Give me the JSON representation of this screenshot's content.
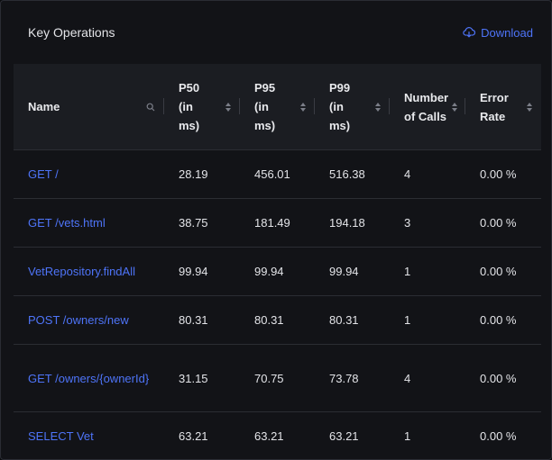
{
  "panel": {
    "title": "Key Operations",
    "download_label": "Download"
  },
  "columns": [
    {
      "label": "Name"
    },
    {
      "label": "P50 (in ms)"
    },
    {
      "label": "P95 (in ms)"
    },
    {
      "label": "P99 (in ms)"
    },
    {
      "label": "Number of Calls"
    },
    {
      "label": "Error Rate"
    }
  ],
  "rows": [
    {
      "name": "GET /",
      "p50": "28.19",
      "p95": "456.01",
      "p99": "516.38",
      "calls": "4",
      "error_rate": "0.00 %"
    },
    {
      "name": "GET /vets.html",
      "p50": "38.75",
      "p95": "181.49",
      "p99": "194.18",
      "calls": "3",
      "error_rate": "0.00 %"
    },
    {
      "name": "VetRepository.findAll",
      "p50": "99.94",
      "p95": "99.94",
      "p99": "99.94",
      "calls": "1",
      "error_rate": "0.00 %"
    },
    {
      "name": "POST /owners/new",
      "p50": "80.31",
      "p95": "80.31",
      "p99": "80.31",
      "calls": "1",
      "error_rate": "0.00 %"
    },
    {
      "name": "GET /owners/{ownerId}",
      "p50": "31.15",
      "p95": "70.75",
      "p99": "73.78",
      "calls": "4",
      "error_rate": "0.00 %"
    },
    {
      "name": "SELECT Vet",
      "p50": "63.21",
      "p95": "63.21",
      "p99": "63.21",
      "calls": "1",
      "error_rate": "0.00 %"
    }
  ],
  "colors": {
    "accent": "#4e74f8",
    "background": "#121317",
    "header_bg": "#1b1d22"
  },
  "icons": {
    "download": "cloud-download-icon",
    "search": "search-icon",
    "sort": "sort-icon"
  }
}
